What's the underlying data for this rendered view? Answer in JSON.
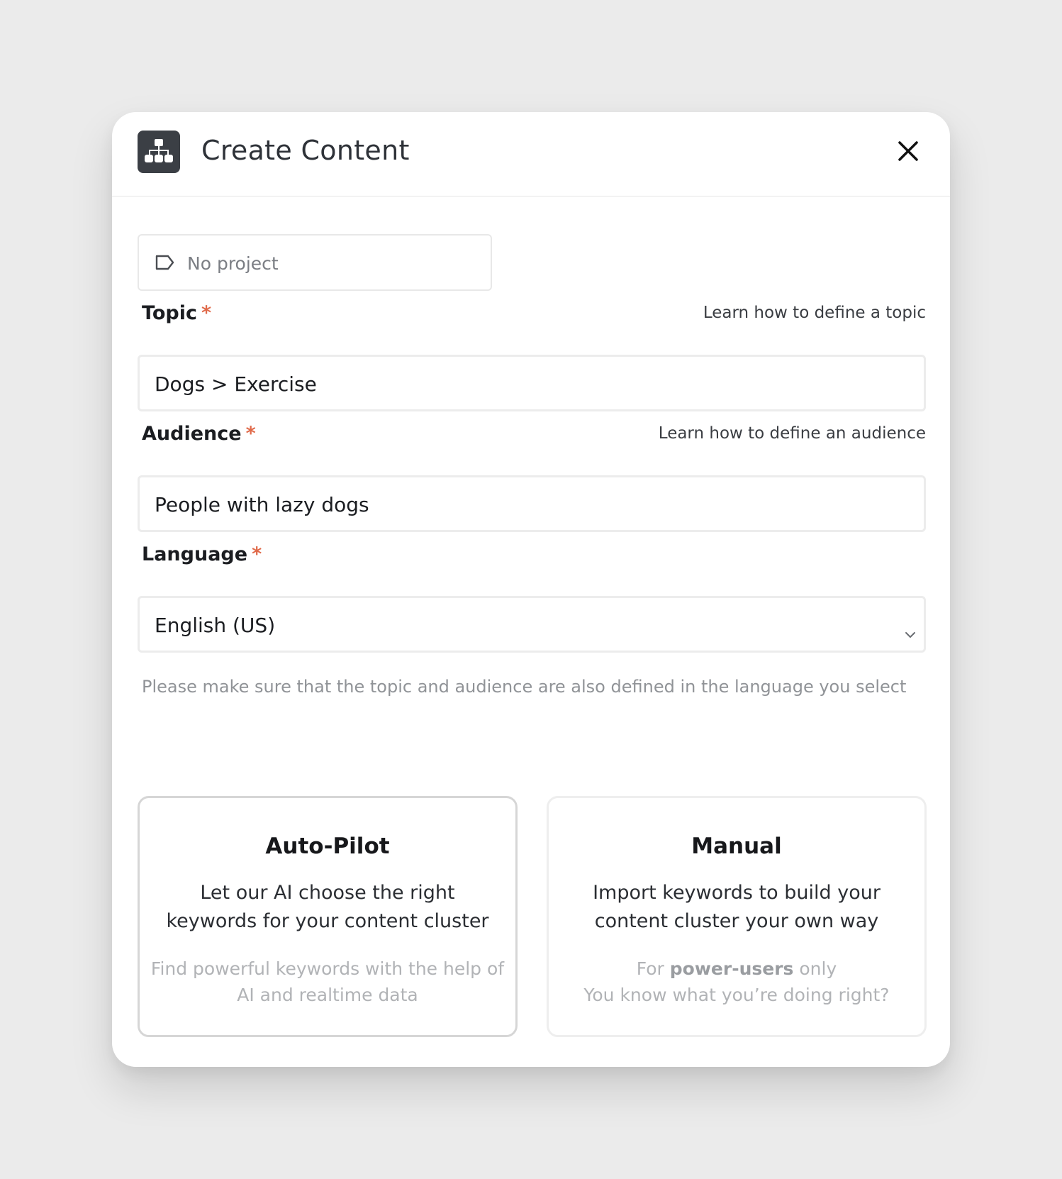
{
  "modal": {
    "title": "Create Content",
    "logo_icon": "sitemap-icon",
    "close_icon": "close-icon"
  },
  "project": {
    "icon": "tag-icon",
    "placeholder": "No project"
  },
  "topic": {
    "label": "Topic",
    "required_mark": "*",
    "help_link": "Learn how to define a topic",
    "value": "Dogs > Exercise"
  },
  "audience": {
    "label": "Audience",
    "required_mark": "*",
    "help_link": "Learn how to define an audience",
    "value": "People with lazy dogs"
  },
  "language": {
    "label": "Language",
    "required_mark": "*",
    "value": "English (US)",
    "icon": "chevron-down-icon"
  },
  "note": "Please make sure that the topic and audience are also defined in the language you select",
  "cards": {
    "auto": {
      "title": "Auto-Pilot",
      "description": "Let our AI choose the right keywords for your content cluster",
      "subtitle": "Find powerful keywords with the help of AI and realtime data"
    },
    "manual": {
      "title": "Manual",
      "description": "Import keywords to build your content cluster your own way",
      "sub_prefix": "For",
      "sub_bold": "power-users",
      "sub_suffix": "only",
      "sub_line2": "You know what you’re doing right?"
    }
  },
  "colors": {
    "background": "#ebebeb",
    "required": "#e06a4a",
    "logo_bg": "#3b3f45"
  }
}
